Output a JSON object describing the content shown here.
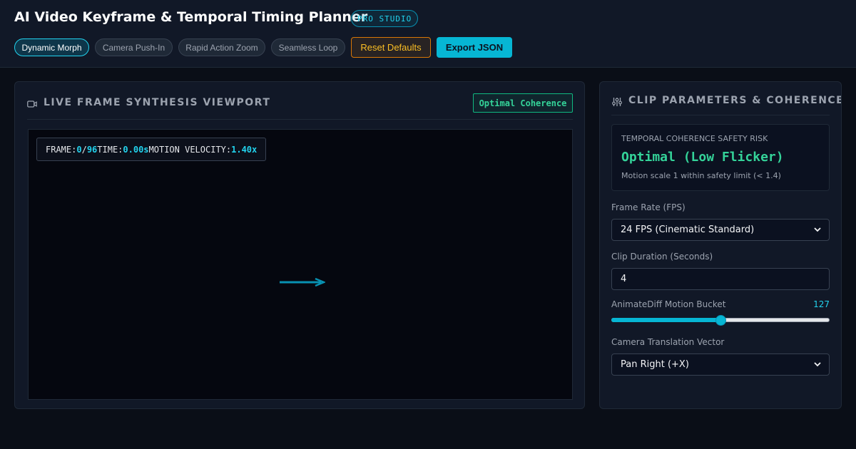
{
  "header": {
    "title": "AI Video Keyframe & Temporal Timing Planner",
    "badge": "PRO STUDIO"
  },
  "toolbar": {
    "presets": [
      {
        "label": "Dynamic Morph",
        "active": true
      },
      {
        "label": "Camera Push-In",
        "active": false
      },
      {
        "label": "Rapid Action Zoom",
        "active": false
      },
      {
        "label": "Seamless Loop",
        "active": false
      }
    ],
    "reset_label": "Reset Defaults",
    "export_label": "Export JSON"
  },
  "viewport_panel": {
    "title": "LIVE FRAME SYNTHESIS VIEWPORT",
    "status": "Optimal Coherence",
    "hud": {
      "frame_label": "FRAME:",
      "frame_current": "0",
      "frame_sep": "/",
      "frame_total": "96",
      "time_label": "TIME:",
      "time_value": "0.00s",
      "velocity_label": "MOTION VELOCITY:",
      "velocity_value": "1.40x"
    }
  },
  "params_panel": {
    "title": "CLIP PARAMETERS & COHERENCE",
    "risk": {
      "label": "TEMPORAL COHERENCE SAFETY RISK",
      "value": "Optimal (Low Flicker)",
      "note": "Motion scale 1 within safety limit (< 1.4)"
    },
    "frame_rate": {
      "label": "Frame Rate (FPS)",
      "value": "24 FPS (Cinematic Standard)"
    },
    "duration": {
      "label": "Clip Duration (Seconds)",
      "value": "4"
    },
    "motion_bucket": {
      "label": "AnimateDiff Motion Bucket",
      "value": "127",
      "fraction": 0.5
    },
    "camera_vector": {
      "label": "Camera Translation Vector",
      "value": "Pan Right (+X)"
    }
  },
  "colors": {
    "accent": "#06b6d4",
    "success": "#34d399",
    "warning": "#fbbf24",
    "grid_cyan": "#0e7490",
    "grid_purple": "#6d28d9"
  },
  "icons": {
    "viewport": "video-camera-icon",
    "params": "sliders-icon",
    "motion": "arrow-right-icon",
    "select": "chevron-down-icon"
  }
}
